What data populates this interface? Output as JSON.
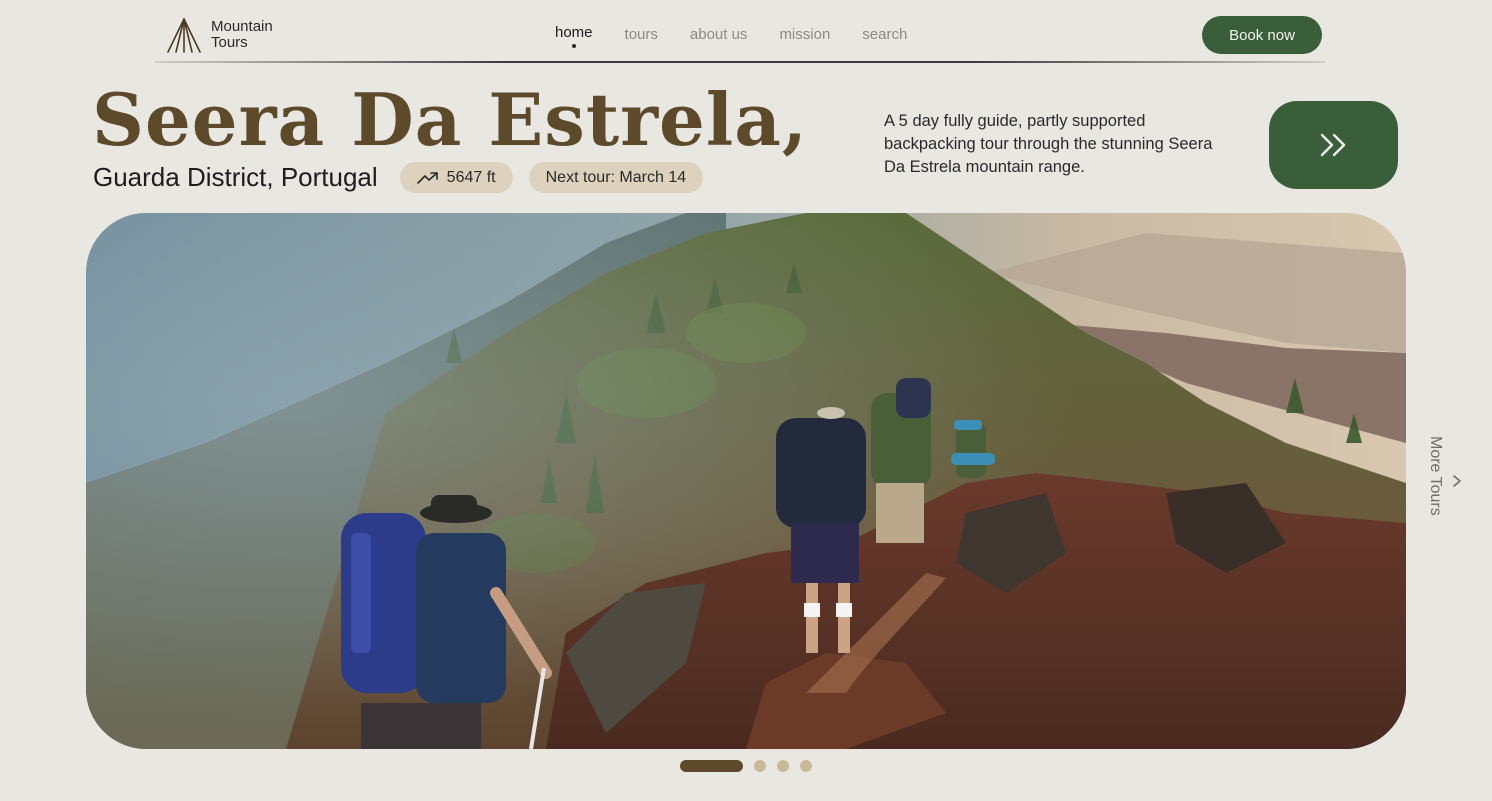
{
  "brand": {
    "line1": "Mountain",
    "line2": "Tours",
    "logo_icon": "mountain-lines-icon"
  },
  "nav": {
    "items": [
      {
        "label": "home",
        "active": true
      },
      {
        "label": "tours",
        "active": false
      },
      {
        "label": "about us",
        "active": false
      },
      {
        "label": "mission",
        "active": false
      },
      {
        "label": "search",
        "active": false
      }
    ],
    "cta_label": "Book now"
  },
  "hero": {
    "title": "Seera Da Estrela,",
    "location": "Guarda District, Portugal",
    "elevation": "5647 ft",
    "elevation_icon": "trend-up-icon",
    "next_tour": "Next tour: March 14",
    "description": "A 5 day fully guide, partly supported backpacking tour through the stunning Seera Da Estrela mountain range.",
    "next_icon": "double-chevron-right-icon",
    "image_alt": "hikers-on-mountain-ridge"
  },
  "side": {
    "more_tours_label": "More Tours",
    "arrow_icon": "chevron-right-icon"
  },
  "pager": {
    "count": 4,
    "active_index": 0
  },
  "colors": {
    "background": "#e9e7e2",
    "accent_green": "#3b5e3a",
    "title_brown": "#5d4a2b",
    "chip_beige": "#ddd2bd",
    "dot_inactive": "#c9b99a"
  }
}
